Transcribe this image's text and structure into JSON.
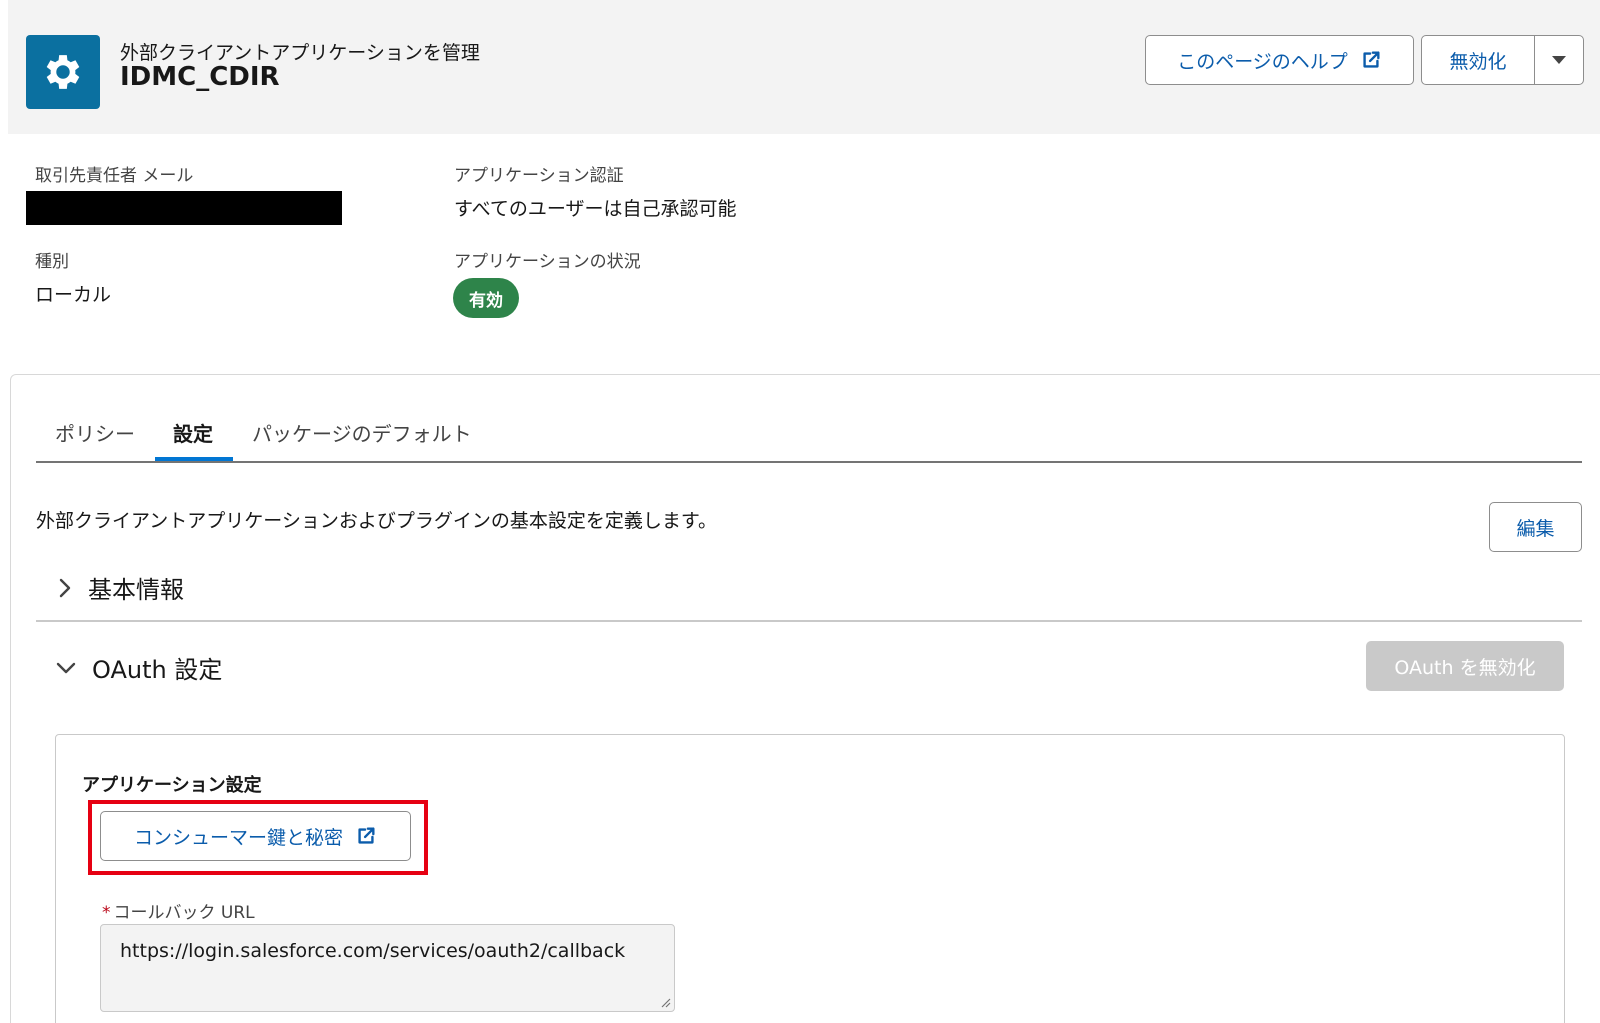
{
  "header": {
    "subtitle": "外部クライアントアプリケーションを管理",
    "title": "IDMC_CDIR",
    "help_button": "このページのヘルプ",
    "deactivate_button": "無効化"
  },
  "details": {
    "contact_email_label": "取引先責任者 メール",
    "app_auth_label": "アプリケーション認証",
    "app_auth_value": "すべてのユーザーは自己承認可能",
    "type_label": "種別",
    "type_value": "ローカル",
    "app_status_label": "アプリケーションの状況",
    "app_status_value": "有効"
  },
  "tabs": [
    {
      "label": "ポリシー"
    },
    {
      "label": "設定"
    },
    {
      "label": "パッケージのデフォルト"
    }
  ],
  "settings": {
    "description": "外部クライアントアプリケーションおよびプラグインの基本設定を定義します。",
    "edit_button": "編集",
    "basic_info_title": "基本情報",
    "oauth_title": "OAuth 設定",
    "disable_oauth_button": "OAuth を無効化",
    "app_settings_title": "アプリケーション設定",
    "consumer_key_button": "コンシューマー鍵と秘密",
    "callback_label": "コールバック URL",
    "callback_value": "https://login.salesforce.com/services/oauth2/callback"
  },
  "colors": {
    "brand_blue": "#0b5cab",
    "icon_bg": "#0b70a0",
    "status_green": "#2e844a",
    "highlight_red": "#e60012",
    "tab_active": "#0176d3"
  }
}
